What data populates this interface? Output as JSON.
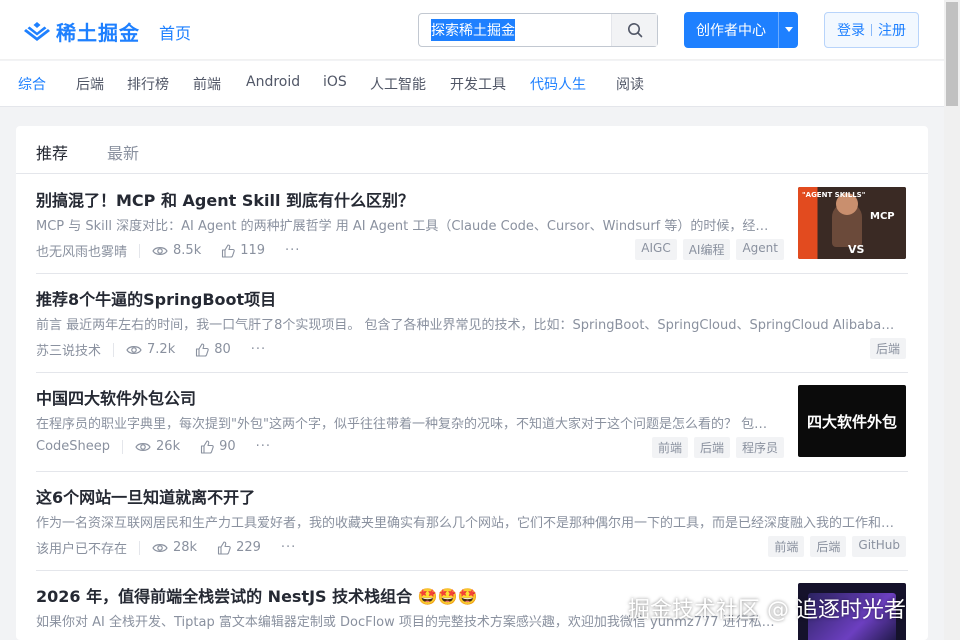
{
  "header": {
    "logo_text": "稀土掘金",
    "home": "首页",
    "search_placeholder": "探索稀土掘金",
    "creator": "创作者中心",
    "login": "登录",
    "register": "注册"
  },
  "categories": [
    "综合",
    "后端",
    "排行榜",
    "前端",
    "Android",
    "iOS",
    "人工智能",
    "开发工具",
    "代码人生",
    "阅读"
  ],
  "tabs": [
    "推荐",
    "最新"
  ],
  "articles": [
    {
      "title": "别搞混了！MCP 和 Agent Skill 到底有什么区别？",
      "abstract": "MCP 与 Skill 深度对比：AI Agent 的两种扩展哲学 用 AI Agent 工具（Claude Code、Cursor、Windsurf 等）的时候，经常…",
      "author": "也无风雨也雾晴",
      "views": "8.5k",
      "likes": "119",
      "tags": [
        "AIGC",
        "AI编程",
        "Agent"
      ],
      "thumb_text_top": "\"AGENT SKILLS\"",
      "thumb_text_mcp": "MCP",
      "thumb_text_vs": "VS"
    },
    {
      "title": "推荐8个牛逼的SpringBoot项目",
      "abstract": "前言 最近两年左右的时间，我一口气肝了8个实现项目。 包含了各种业界常见的技术，比如：SpringBoot、SpringCloud、SpringCloud Alibaba、…",
      "author": "苏三说技术",
      "views": "7.2k",
      "likes": "80",
      "tags": [
        "后端"
      ]
    },
    {
      "title": "中国四大软件外包公司",
      "abstract": "在程序员的职业字典里，每次提到\"外包\"这两个字，似乎往往带着一种复杂的况味，不知道大家对于这个问题是怎么看的？ 包…",
      "author": "CodeSheep",
      "views": "26k",
      "likes": "90",
      "tags": [
        "前端",
        "后端",
        "程序员"
      ],
      "thumb_text": "四大软件外包"
    },
    {
      "title": "这6个网站一旦知道就离不开了",
      "abstract": "作为一名资深互联网居民和生产力工具爱好者，我的收藏夹里确实有那么几个网站，它们不是那种偶尔用一下的工具，而是已经深度融入我的工作和生…",
      "author": "该用户已不存在",
      "views": "28k",
      "likes": "229",
      "tags": [
        "前端",
        "后端",
        "GitHub"
      ]
    },
    {
      "title": "2026 年，值得前端全栈尝试的 NestJS 技术栈组合 🤩🤩🤩",
      "abstract": "如果你对 AI 全栈开发、Tiptap 富文本编辑器定制或 DocFlow 项目的完整技术方案感兴趣，欢迎加我微信 yunmz777 进行私…",
      "author": "",
      "views": "",
      "likes": "",
      "tags": []
    }
  ],
  "watermark": "掘金技术社区 @ 追逐时光者",
  "colors": {
    "brand": "#1e80ff",
    "text": "#252933",
    "muted": "#8a919f"
  }
}
